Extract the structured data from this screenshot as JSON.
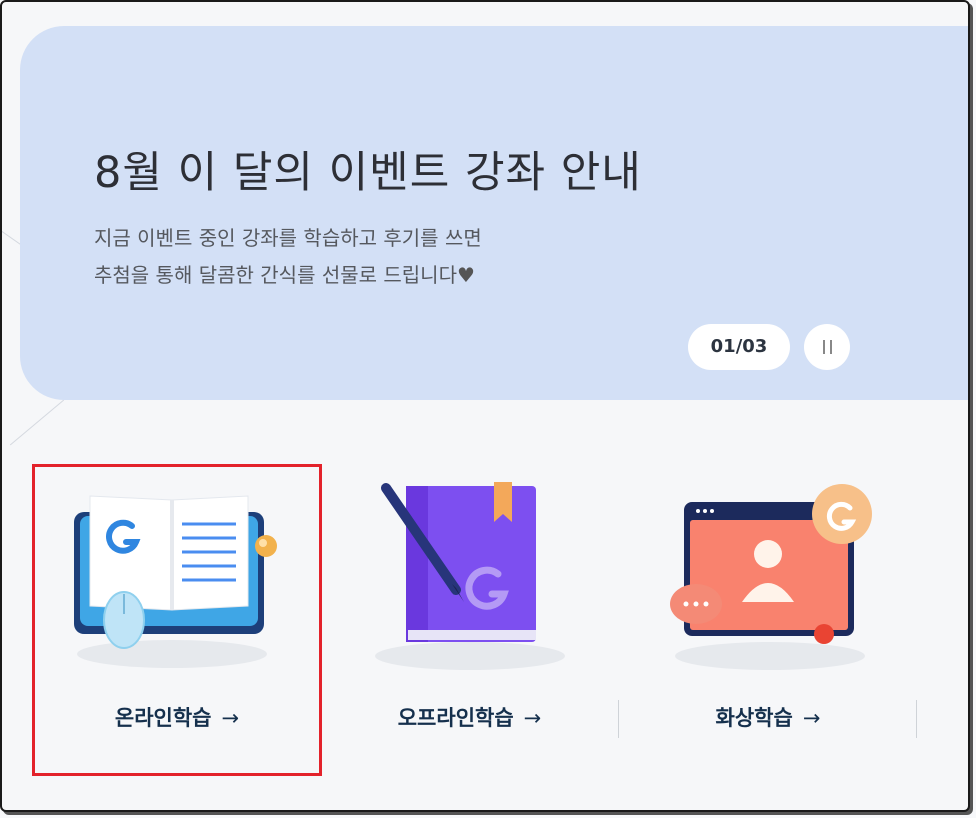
{
  "banner": {
    "title": "8월 이 달의 이벤트 강좌 안내",
    "desc_line1": "지금 이벤트 중인 강좌를 학습하고 후기를 쓰면",
    "desc_line2": "추첨을 통해 달콤한 간식를 선물로 드립니다",
    "heart": "♥",
    "pager": "01/03"
  },
  "categories": [
    {
      "label": "온라인학습",
      "arrow": "→",
      "icon": "open-book-icon"
    },
    {
      "label": "오프라인학습",
      "arrow": "→",
      "icon": "purple-book-pencil-icon"
    },
    {
      "label": "화상학습",
      "arrow": "→",
      "icon": "video-call-icon"
    }
  ],
  "colors": {
    "banner_bg": "#d3e0f6",
    "highlight": "#e3222b",
    "label": "#15304d"
  }
}
